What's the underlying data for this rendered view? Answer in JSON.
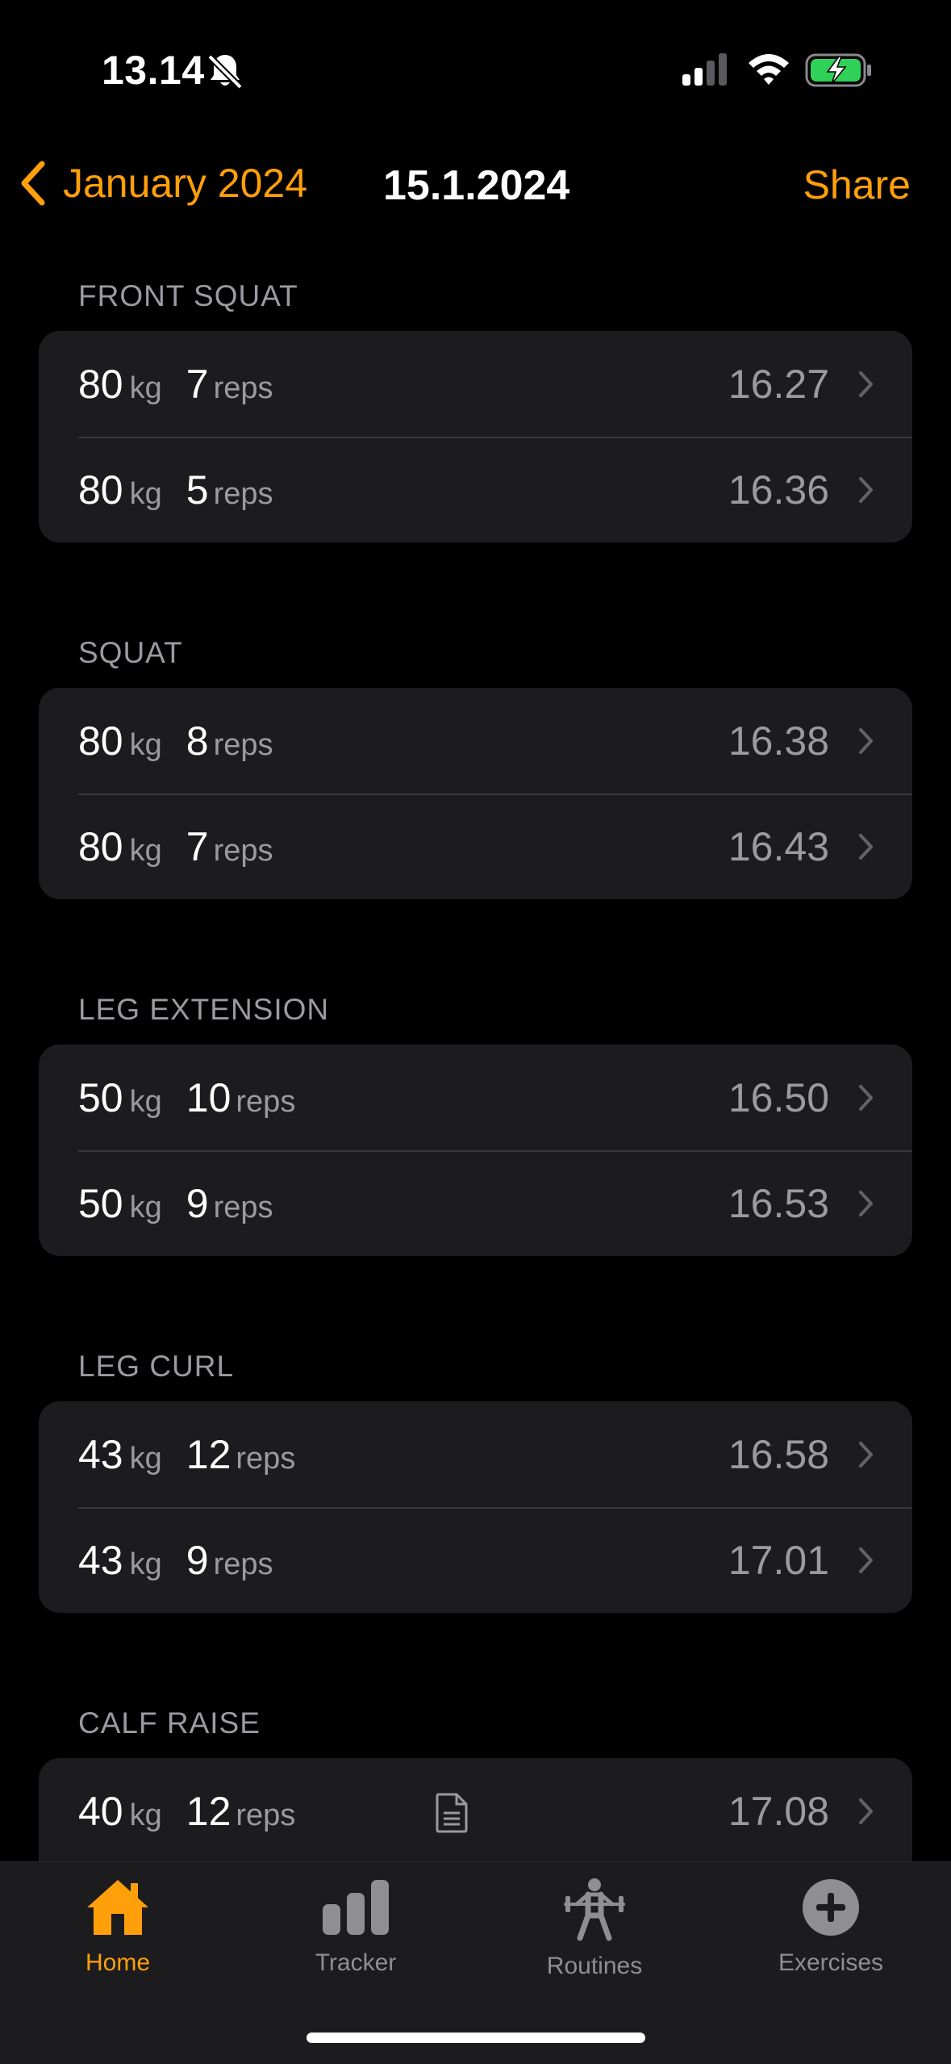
{
  "status": {
    "time": "13.14"
  },
  "nav": {
    "back_label": "January 2024",
    "title": "15.1.2024",
    "share_label": "Share"
  },
  "units": {
    "weight": "kg",
    "reps": "reps"
  },
  "sections": [
    {
      "title": "FRONT SQUAT",
      "sets": [
        {
          "weight": "80",
          "reps": "7",
          "time": "16.27"
        },
        {
          "weight": "80",
          "reps": "5",
          "time": "16.36"
        }
      ]
    },
    {
      "title": "SQUAT",
      "sets": [
        {
          "weight": "80",
          "reps": "8",
          "time": "16.38"
        },
        {
          "weight": "80",
          "reps": "7",
          "time": "16.43"
        }
      ]
    },
    {
      "title": "LEG EXTENSION",
      "sets": [
        {
          "weight": "50",
          "reps": "10",
          "time": "16.50"
        },
        {
          "weight": "50",
          "reps": "9",
          "time": "16.53"
        }
      ]
    },
    {
      "title": "LEG CURL",
      "sets": [
        {
          "weight": "43",
          "reps": "12",
          "time": "16.58"
        },
        {
          "weight": "43",
          "reps": "9",
          "time": "17.01"
        }
      ]
    },
    {
      "title": "CALF RAISE",
      "sets": [
        {
          "weight": "40",
          "reps": "12",
          "time": "17.08",
          "note_icon": "document-icon"
        }
      ]
    }
  ],
  "tabs": [
    {
      "label": "Home",
      "icon": "house-icon",
      "active": true
    },
    {
      "label": "Tracker",
      "icon": "bar-chart-icon"
    },
    {
      "label": "Routines",
      "icon": "weightlifter-icon"
    },
    {
      "label": "Exercises",
      "icon": "plus-circle-icon"
    }
  ],
  "colors": {
    "accent": "#ff9f0a",
    "card": "#1c1c1e",
    "secondary_text": "#9a9aa0"
  }
}
